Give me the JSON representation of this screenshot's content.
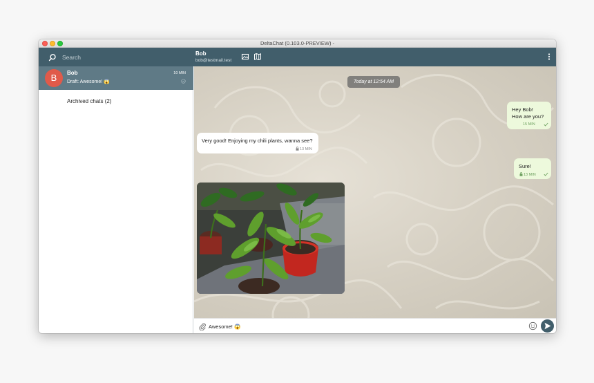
{
  "window": {
    "title": "DeltaChat (0.103.0-PREVIEW) -"
  },
  "sidebar": {
    "search_placeholder": "Search",
    "chats": [
      {
        "initial": "B",
        "name": "Bob",
        "time": "10 MIN",
        "draft": "Draft: Awesome! 😱"
      }
    ],
    "archived_label": "Archived chats (2)"
  },
  "chat": {
    "contact_name": "Bob",
    "contact_email": "bob@testmail.test",
    "date_marker": "Today at 12:54 AM",
    "messages": [
      {
        "direction": "out",
        "text": "Hey Bob!\nHow are you?",
        "time": "15 MIN",
        "encrypted": false
      },
      {
        "direction": "in",
        "text": "Very good! Enjoying my chili plants, wanna see?",
        "time": "13 MIN",
        "encrypted": true
      },
      {
        "direction": "out",
        "text": "Sure!",
        "time": "13 MIN",
        "encrypted": true
      },
      {
        "direction": "in",
        "type": "image",
        "depicts": "potted chili pepper plants"
      }
    ]
  },
  "composer": {
    "value": "Awesome! 😱"
  },
  "icons": {
    "search": "search-icon",
    "gallery": "gallery-icon",
    "map": "map-icon",
    "menu": "vertical-dots-menu-icon",
    "attach": "paperclip-icon",
    "emoji": "emoji-icon",
    "send": "send-icon",
    "lock": "lock-icon",
    "check": "check-icon"
  },
  "colors": {
    "header": "#415e6b",
    "selected_chat": "#5f7a86",
    "avatar": "#e05a4a",
    "outgoing_bubble": "#edf9dc",
    "incoming_bubble": "#ffffff"
  }
}
